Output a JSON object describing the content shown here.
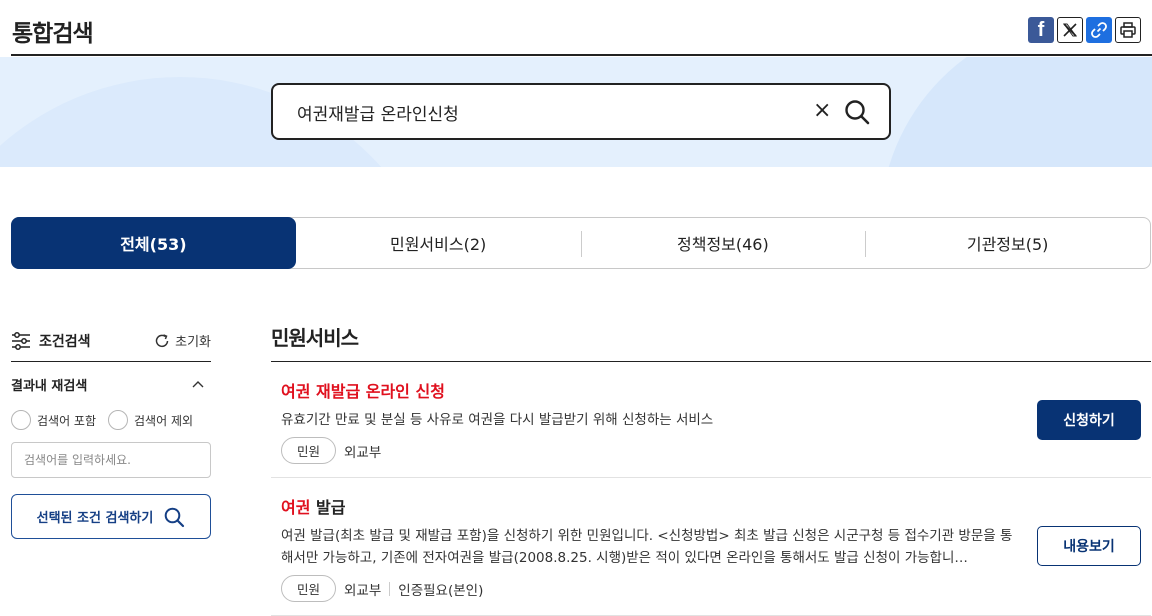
{
  "header": {
    "title": "통합검색",
    "share": [
      {
        "name": "facebook-share-button",
        "icon": "facebook-icon",
        "label": "f"
      },
      {
        "name": "x-share-button",
        "icon": "x-icon"
      },
      {
        "name": "copy-link-button",
        "icon": "link-icon"
      },
      {
        "name": "print-button",
        "icon": "print-icon"
      }
    ]
  },
  "search": {
    "value": "여권재발급 온라인신청",
    "clear_label": "×"
  },
  "tabs": [
    {
      "label": "전체(53)",
      "active": true
    },
    {
      "label": "민원서비스(2)",
      "active": false
    },
    {
      "label": "정책정보(46)",
      "active": false
    },
    {
      "label": "기관정보(5)",
      "active": false
    }
  ],
  "filter": {
    "title": "조건검색",
    "reset_label": "초기화",
    "sub_title": "결과내 재검색",
    "radios": [
      "검색어 포함",
      "검색어 제외"
    ],
    "input_placeholder": "검색어를 입력하세요.",
    "apply_label": "선택된 조건 검색하기"
  },
  "results": {
    "section_title": "민원서비스",
    "items": [
      {
        "title_highlight": "여권 재발급 온라인 신청",
        "title_rest": "",
        "desc": "유효기간 만료 및 분실 등 사유로 여권을 다시 발급받기 위해 신청하는 서비스",
        "badge": "민원",
        "org": "외교부",
        "extra": "",
        "button": "신청하기"
      },
      {
        "title_highlight": "여권",
        "title_rest": " 발급",
        "desc": "여권 발급(최초 발급 및 재발급 포함)을 신청하기 위한 민원입니다. <신청방법> 최초 발급 신청은 시군구청 등 접수기관 방문을 통해서만 가능하고, 기존에 전자여권을 발급(2008.8.25. 시행)받은 적이 있다면 온라인을 통해서도 발급 신청이 가능합니…",
        "badge": "민원",
        "org": "외교부",
        "extra": "인증필요(본인)",
        "button": "내용보기"
      }
    ]
  },
  "colors": {
    "primary": "#083374",
    "highlight": "#e0101e",
    "hero_bg": "#e4f0fd"
  }
}
